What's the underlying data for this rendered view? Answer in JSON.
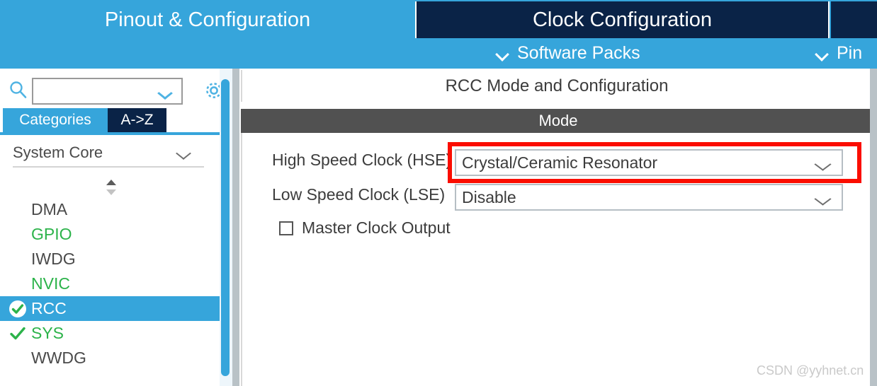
{
  "header": {
    "tabs": [
      {
        "label": "Pinout & Configuration",
        "active": false,
        "name": "tab-pinout-configuration"
      },
      {
        "label": "Clock Configuration",
        "active": true,
        "name": "tab-clock-configuration"
      }
    ],
    "submenu": [
      {
        "label": "Software Packs",
        "icon": "chevron-down-icon"
      },
      {
        "label": "Pin",
        "icon": "chevron-down-icon"
      }
    ]
  },
  "sidebar": {
    "search": {
      "value": "",
      "placeholder": "",
      "icon": "search-icon",
      "chevron": "chevron-down-icon"
    },
    "settings_icon": "gear-icon",
    "tabs": [
      {
        "label": "Categories",
        "active": true
      },
      {
        "label": "A->Z",
        "active": false
      }
    ],
    "category": {
      "label": "System Core",
      "chevron": "chevron-down-icon",
      "sort_icon": "sort-updown-icon"
    },
    "items": [
      {
        "label": "DMA",
        "state": "none",
        "selected": false
      },
      {
        "label": "GPIO",
        "state": "green",
        "selected": false
      },
      {
        "label": "IWDG",
        "state": "none",
        "selected": false
      },
      {
        "label": "NVIC",
        "state": "green",
        "selected": false
      },
      {
        "label": "RCC",
        "state": "checked",
        "selected": true
      },
      {
        "label": "SYS",
        "state": "check",
        "selected": false
      },
      {
        "label": "WWDG",
        "state": "none",
        "selected": false
      }
    ],
    "scrollbar": "vertical-scrollbar"
  },
  "main": {
    "title": "RCC Mode and Configuration",
    "mode_header": "Mode",
    "fields": [
      {
        "label": "High Speed Clock (HSE)",
        "value": "Crystal/Ceramic Resonator",
        "chevron": "chevron-down-icon",
        "highlighted": true
      },
      {
        "label": "Low Speed Clock (LSE)",
        "value": "Disable",
        "chevron": "chevron-down-icon",
        "highlighted": false
      }
    ],
    "checkbox": {
      "label": "Master Clock Output",
      "checked": false
    }
  },
  "watermark": "CSDN @yyhnet.cn",
  "colors": {
    "accent_blue": "#36a5db",
    "dark_navy": "#0a2347",
    "mode_gray": "#515151",
    "green": "#2cb34a",
    "highlight_red": "#fb0d00",
    "divider_gray": "#b9c2c7"
  }
}
